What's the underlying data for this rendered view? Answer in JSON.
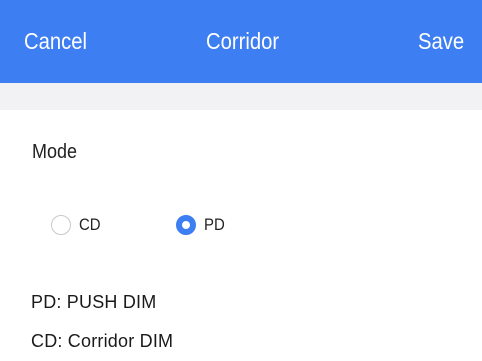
{
  "navbar": {
    "cancel_label": "Cancel",
    "title": "Corridor",
    "save_label": "Save",
    "color": "#3d7ef2"
  },
  "mode": {
    "label": "Mode",
    "options": [
      {
        "label": "CD",
        "selected": false
      },
      {
        "label": "PD",
        "selected": true
      }
    ]
  },
  "info": {
    "pd_line": "PD:  PUSH DIM",
    "cd_line": "CD:  Corridor DIM"
  }
}
